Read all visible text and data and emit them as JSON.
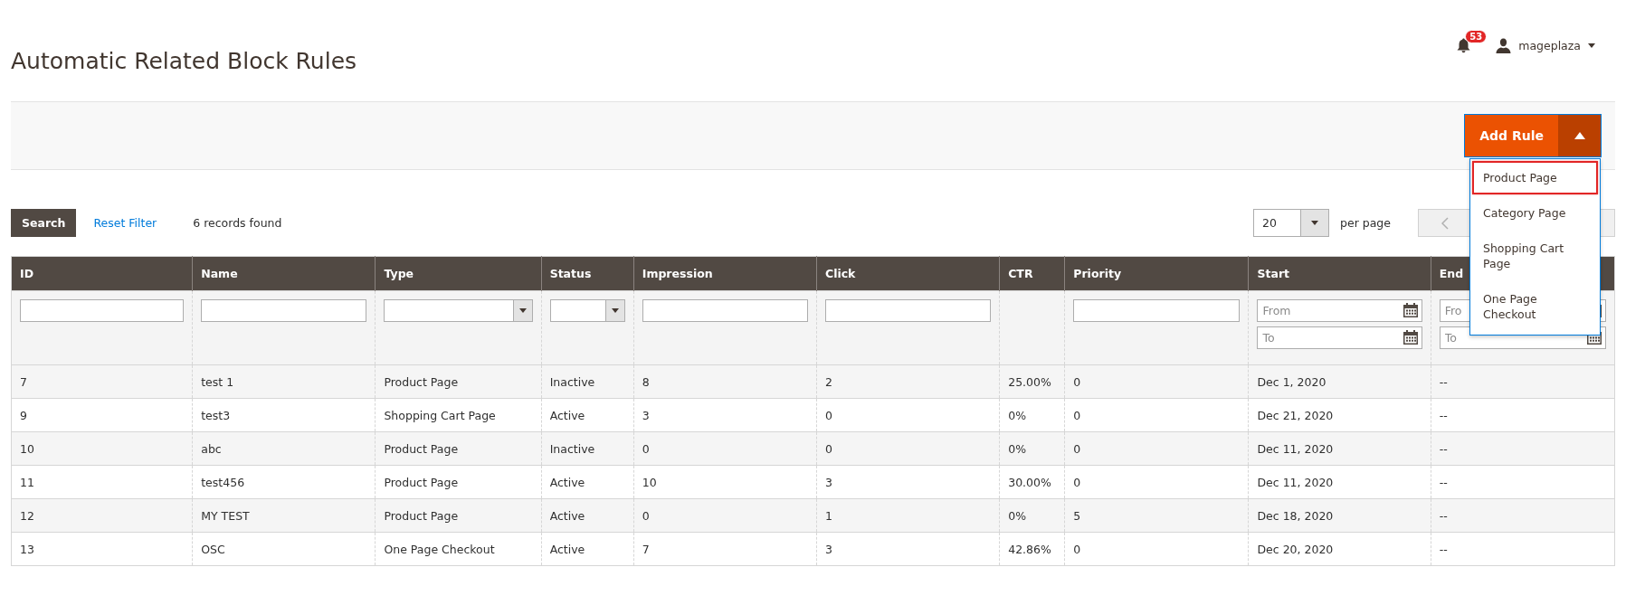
{
  "header": {
    "title": "Automatic Related Block Rules",
    "notifications": "53",
    "user": "mageplaza"
  },
  "actions": {
    "add_button": {
      "label": "Add Rule",
      "expanded": true
    },
    "menu": [
      {
        "label": "Product Page",
        "selected": true
      },
      {
        "label": "Category Page",
        "selected": false
      },
      {
        "label": "Shopping Cart Page",
        "selected": false
      },
      {
        "label": "One Page Checkout",
        "selected": false
      }
    ]
  },
  "toolbar": {
    "search_button": "Search",
    "reset_link": "Reset Filter",
    "records": "6 records found",
    "page_size": "20",
    "per_page": "per page"
  },
  "table": {
    "columns": [
      {
        "label": "ID",
        "kind": "text"
      },
      {
        "label": "Name",
        "kind": "text"
      },
      {
        "label": "Type",
        "kind": "select"
      },
      {
        "label": "Status",
        "kind": "select"
      },
      {
        "label": "Impression",
        "kind": "text"
      },
      {
        "label": "Click",
        "kind": "text"
      },
      {
        "label": "CTR",
        "kind": "none"
      },
      {
        "label": "Priority",
        "kind": "text"
      },
      {
        "label": "Start",
        "kind": "date",
        "date_fields": [
          {
            "placeholder": "From"
          },
          {
            "placeholder": "To"
          }
        ]
      },
      {
        "label": "End",
        "kind": "date",
        "date_fields": [
          {
            "placeholder": "Fro"
          },
          {
            "placeholder": "To"
          }
        ]
      }
    ],
    "rows": [
      [
        "7",
        "test 1",
        "Product Page",
        "Inactive",
        "8",
        "2",
        "25.00%",
        "0",
        "Dec 1, 2020",
        "--"
      ],
      [
        "9",
        "test3",
        "Shopping Cart Page",
        "Active",
        "3",
        "0",
        "0%",
        "0",
        "Dec 21, 2020",
        "--"
      ],
      [
        "10",
        "abc",
        "Product Page",
        "Inactive",
        "0",
        "0",
        "0%",
        "0",
        "Dec 11, 2020",
        "--"
      ],
      [
        "11",
        "test456",
        "Product Page",
        "Active",
        "10",
        "3",
        "30.00%",
        "0",
        "Dec 11, 2020",
        "--"
      ],
      [
        "12",
        "MY TEST",
        "Product Page",
        "Active",
        "0",
        "1",
        "0%",
        "5",
        "Dec 18, 2020",
        "--"
      ],
      [
        "13",
        "OSC",
        "One Page Checkout",
        "Active",
        "7",
        "3",
        "42.86%",
        "0",
        "Dec 20, 2020",
        "--"
      ]
    ]
  }
}
